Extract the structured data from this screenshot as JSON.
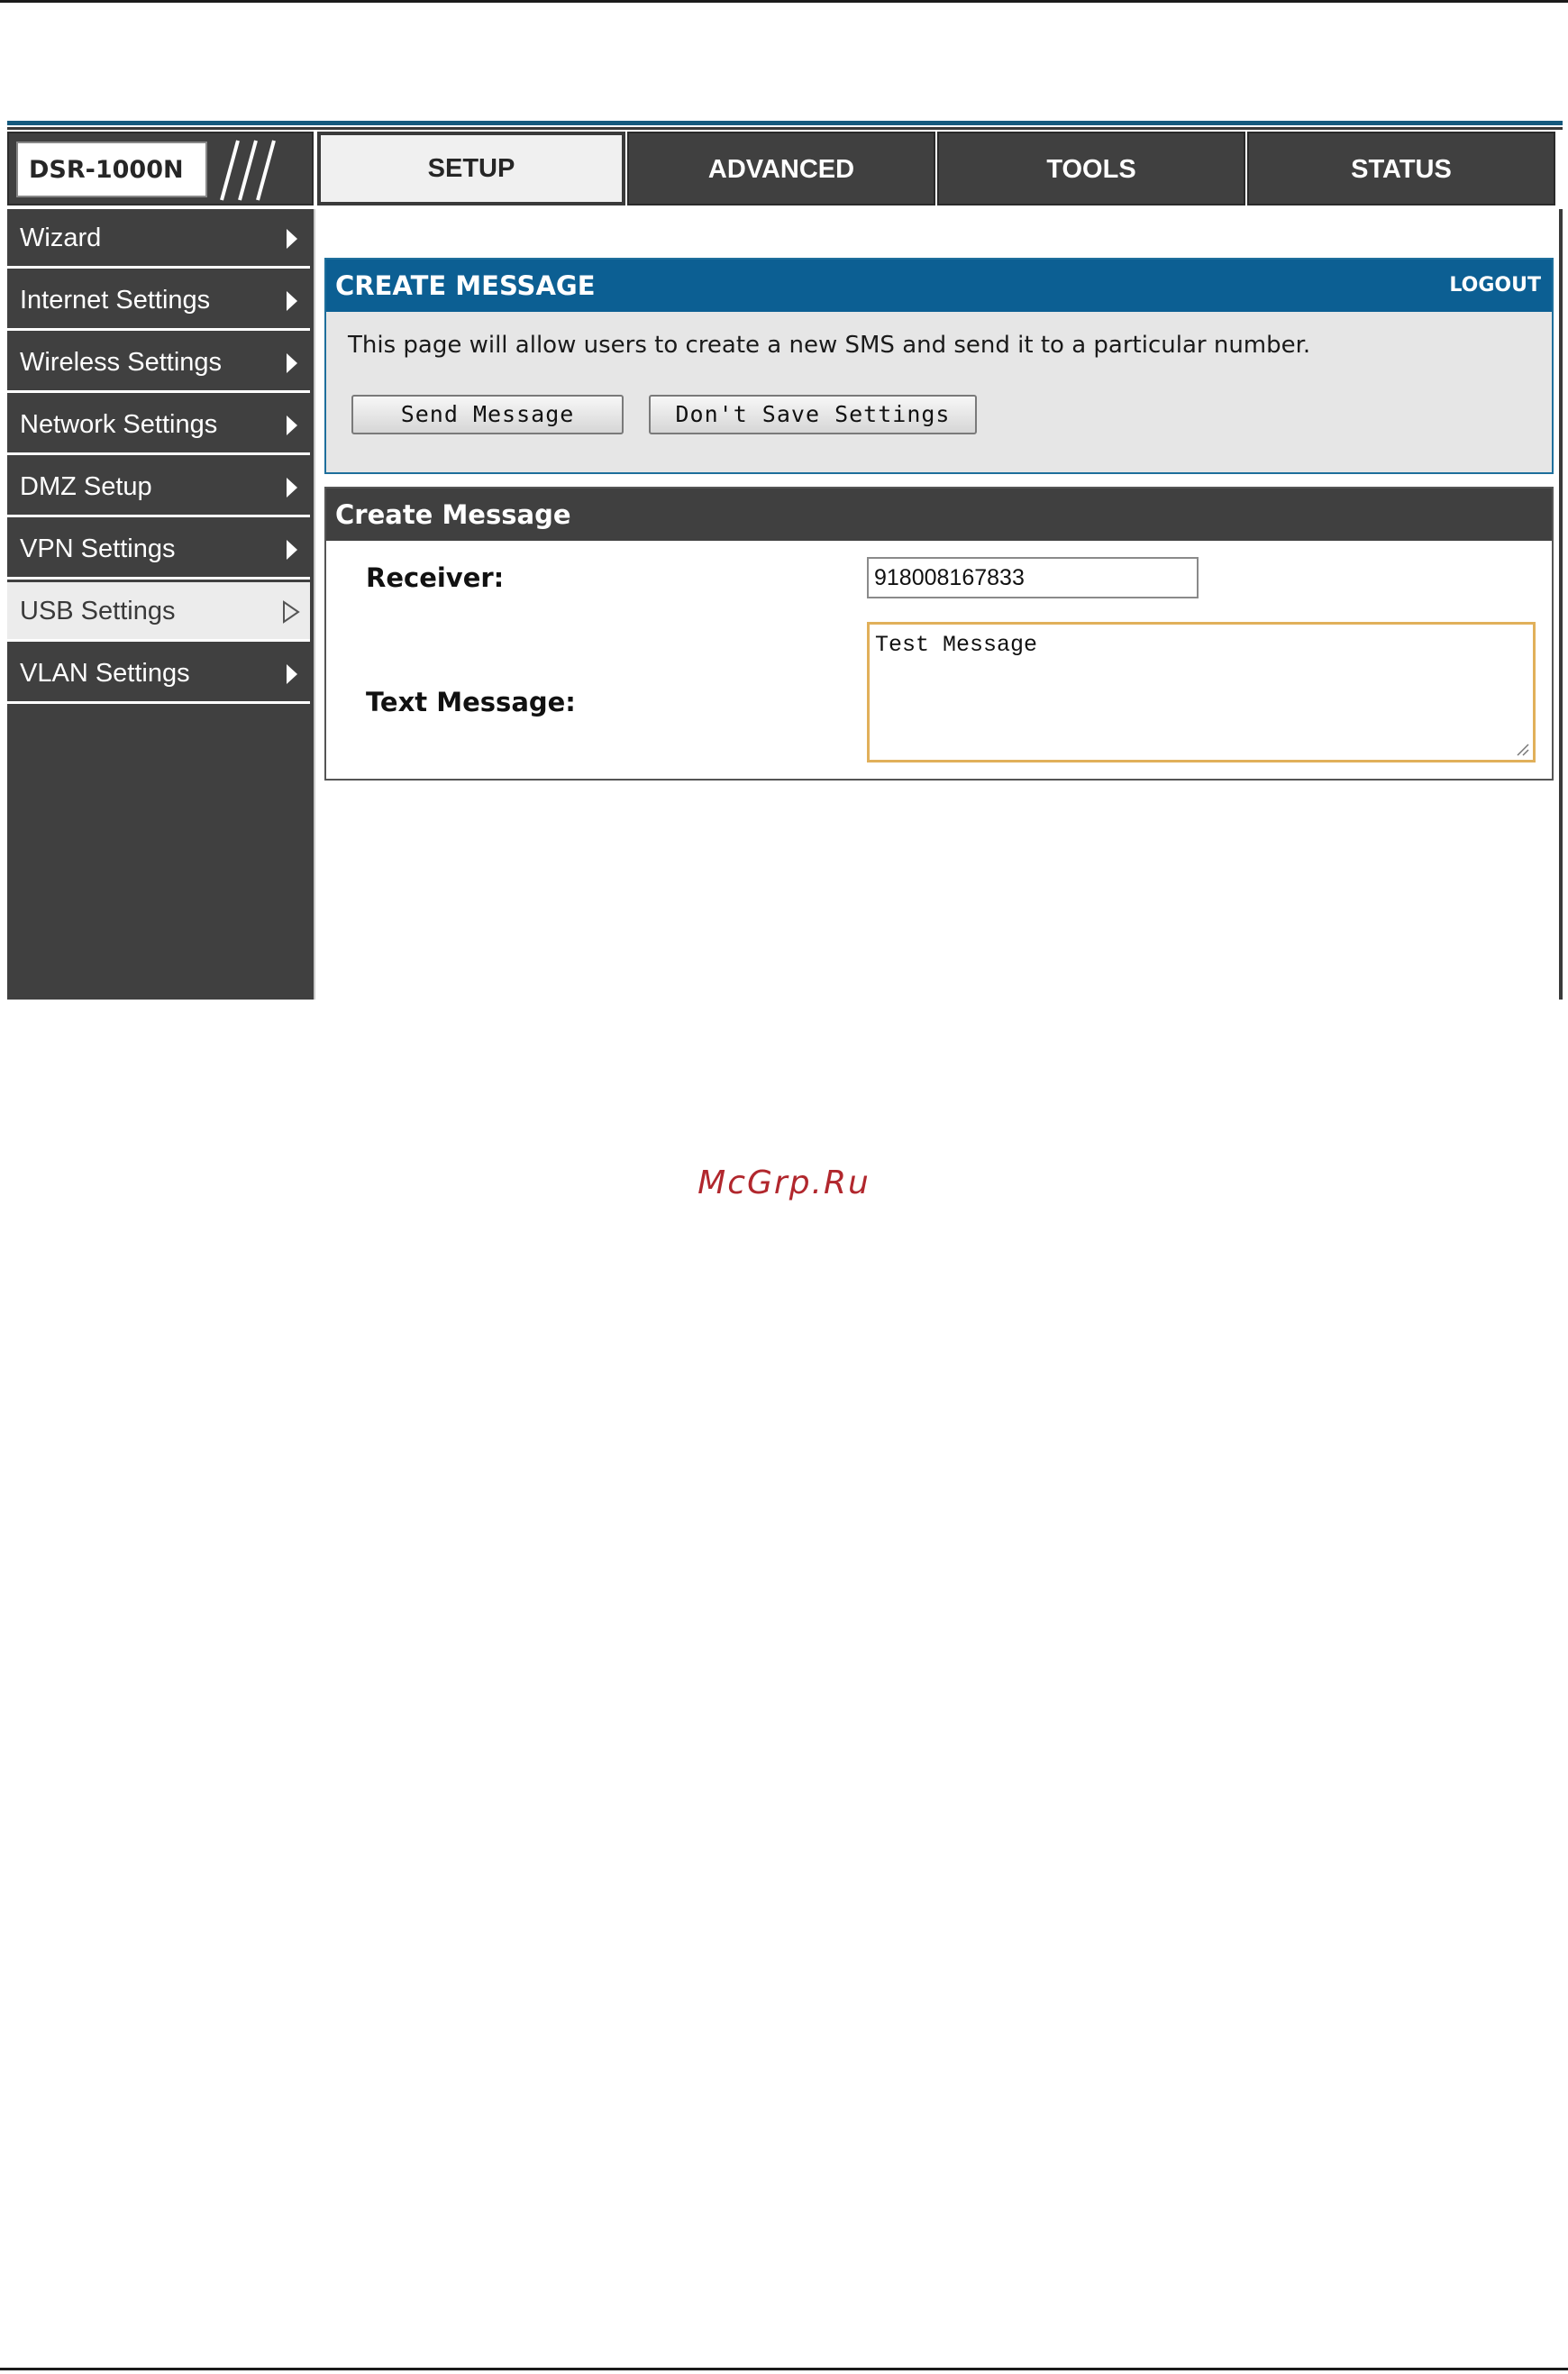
{
  "header": {
    "product": "DSR-1000N",
    "tabs": [
      {
        "label": "SETUP",
        "active": true
      },
      {
        "label": "ADVANCED",
        "active": false
      },
      {
        "label": "TOOLS",
        "active": false
      },
      {
        "label": "STATUS",
        "active": false
      }
    ]
  },
  "sidebar": {
    "items": [
      {
        "label": "Wizard",
        "active": false
      },
      {
        "label": "Internet Settings",
        "active": false
      },
      {
        "label": "Wireless Settings",
        "active": false
      },
      {
        "label": "Network Settings",
        "active": false
      },
      {
        "label": "DMZ Setup",
        "active": false
      },
      {
        "label": "VPN Settings",
        "active": false
      },
      {
        "label": "USB Settings",
        "active": true
      },
      {
        "label": "VLAN Settings",
        "active": false
      }
    ]
  },
  "create_panel": {
    "title": "CREATE MESSAGE",
    "logout": "LOGOUT",
    "description": "This page will allow users to create a new SMS and send it to a particular number.",
    "send_button": "Send Message",
    "dont_save_button": "Don't Save Settings"
  },
  "form": {
    "title": "Create Message",
    "receiver_label": "Receiver:",
    "receiver_value": "918008167833",
    "text_label": "Text Message:",
    "text_value": "Test Message"
  },
  "watermark": "McGrp.Ru",
  "colors": {
    "header_blue": "#0c5f93",
    "dark_gray": "#404040",
    "textarea_focus": "#e1b05a",
    "watermark": "#b1272d"
  }
}
